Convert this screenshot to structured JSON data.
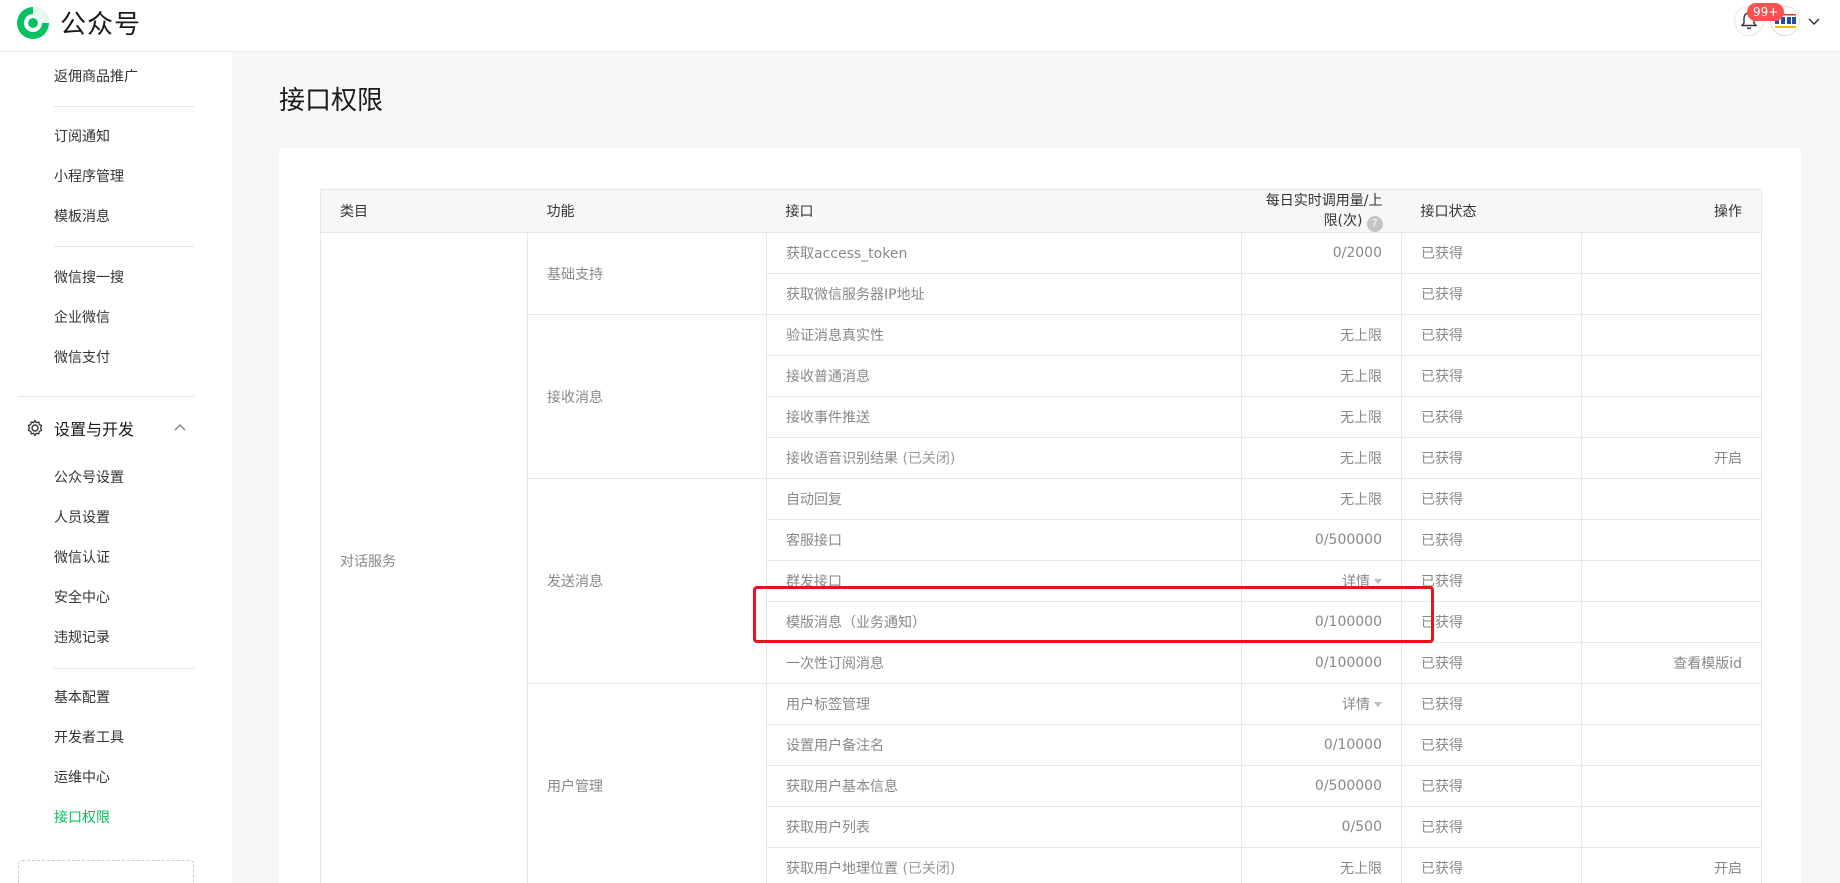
{
  "header": {
    "brand": "公众号",
    "notification_count": "99+"
  },
  "sidebar": {
    "items_top": [
      "返佣商品推广"
    ],
    "group1": [
      "订阅通知",
      "小程序管理",
      "模板消息"
    ],
    "group2": [
      "微信搜一搜",
      "企业微信",
      "微信支付"
    ],
    "section": {
      "label": "设置与开发",
      "icon": "gear-icon"
    },
    "group3": [
      "公众号设置",
      "人员设置",
      "微信认证",
      "安全中心",
      "违规记录"
    ],
    "group4": [
      "基本配置",
      "开发者工具",
      "运维中心",
      "接口权限"
    ],
    "active": "接口权限"
  },
  "main": {
    "title": "接口权限",
    "table": {
      "headers": {
        "category": "类目",
        "function": "功能",
        "api": "接口",
        "usage": "每日实时调用量/上限(次)",
        "status": "接口状态",
        "action": "操作"
      },
      "category": "对话服务",
      "functions": [
        "基础支持",
        "接收消息",
        "发送消息",
        "用户管理"
      ],
      "rows": [
        {
          "api": "获取access_token",
          "note": "",
          "usage": "0/2000",
          "status": "已获得",
          "action": ""
        },
        {
          "api": "获取微信服务器IP地址",
          "note": "",
          "usage": "",
          "status": "已获得",
          "action": ""
        },
        {
          "api": "验证消息真实性",
          "note": "",
          "usage": "无上限",
          "status": "已获得",
          "action": ""
        },
        {
          "api": "接收普通消息",
          "note": "",
          "usage": "无上限",
          "status": "已获得",
          "action": ""
        },
        {
          "api": "接收事件推送",
          "note": "",
          "usage": "无上限",
          "status": "已获得",
          "action": ""
        },
        {
          "api": "接收语音识别结果",
          "note": "(已关闭)",
          "usage": "无上限",
          "status": "已获得",
          "action": "开启"
        },
        {
          "api": "自动回复",
          "note": "",
          "usage": "无上限",
          "status": "已获得",
          "action": ""
        },
        {
          "api": "客服接口",
          "note": "",
          "usage": "0/500000",
          "status": "已获得",
          "action": ""
        },
        {
          "api": "群发接口",
          "note": "",
          "usage": "详情",
          "status": "已获得",
          "action": ""
        },
        {
          "api": "模版消息（业务通知）",
          "note": "",
          "usage": "0/100000",
          "status": "已获得",
          "action": ""
        },
        {
          "api": "一次性订阅消息",
          "note": "",
          "usage": "0/100000",
          "status": "已获得",
          "action": "查看模版id"
        },
        {
          "api": "用户标签管理",
          "note": "",
          "usage": "详情",
          "status": "已获得",
          "action": ""
        },
        {
          "api": "设置用户备注名",
          "note": "",
          "usage": "0/10000",
          "status": "已获得",
          "action": ""
        },
        {
          "api": "获取用户基本信息",
          "note": "",
          "usage": "0/500000",
          "status": "已获得",
          "action": ""
        },
        {
          "api": "获取用户列表",
          "note": "",
          "usage": "0/500",
          "status": "已获得",
          "action": ""
        },
        {
          "api": "获取用户地理位置",
          "note": "(已关闭)",
          "usage": "无上限",
          "status": "已获得",
          "action": "开启"
        }
      ]
    }
  },
  "colors": {
    "brand": "#07c160",
    "link": "#576b95",
    "highlight": "#e8141b",
    "badge": "#fa5151"
  }
}
